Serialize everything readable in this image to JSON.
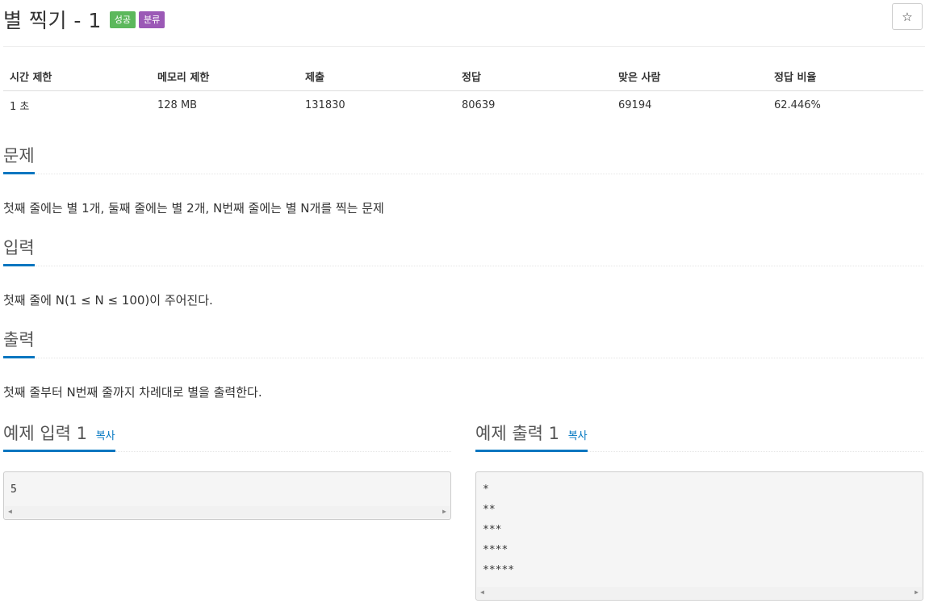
{
  "problem": {
    "title": "별 찍기 - 1",
    "badges": {
      "success": "성공",
      "category": "분류"
    },
    "star_label": "☆"
  },
  "info_table": {
    "headers": [
      "시간 제한",
      "메모리 제한",
      "제출",
      "정답",
      "맞은 사람",
      "정답 비율"
    ],
    "values": [
      "1 초",
      "128 MB",
      "131830",
      "80639",
      "69194",
      "62.446%"
    ]
  },
  "sections": {
    "problem": {
      "heading": "문제",
      "text": "첫째 줄에는 별 1개, 둘째 줄에는 별 2개, N번째 줄에는 별 N개를 찍는 문제"
    },
    "input": {
      "heading": "입력",
      "text": "첫째 줄에 N(1 ≤ N ≤ 100)이 주어진다."
    },
    "output": {
      "heading": "출력",
      "text": "첫째 줄부터 N번째 줄까지 차례대로 별을 출력한다."
    }
  },
  "examples": {
    "input": {
      "heading": "예제 입력 1",
      "copy": "복사",
      "lines": [
        "5"
      ]
    },
    "output": {
      "heading": "예제 출력 1",
      "copy": "복사",
      "lines": [
        "*",
        "**",
        "***",
        "****",
        "*****"
      ]
    }
  },
  "colors": {
    "success_badge": "#5cb85c",
    "category_badge": "#9b59b6",
    "accent": "#0076c0"
  }
}
